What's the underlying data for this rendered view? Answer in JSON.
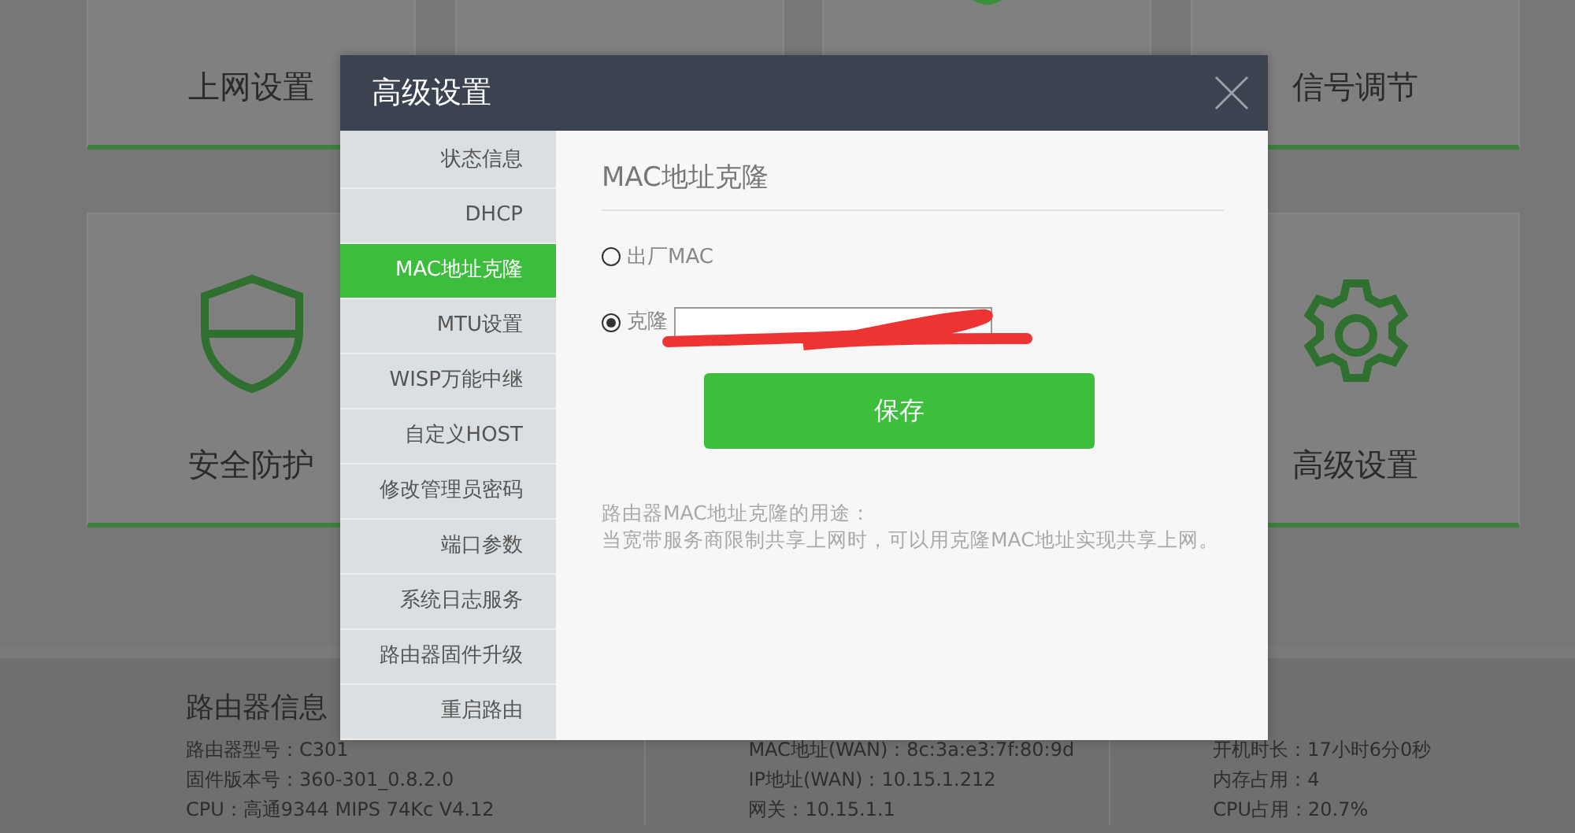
{
  "dashboard": {
    "tile_rows": [
      [
        {
          "kind": "label",
          "label": "上网设置"
        },
        {
          "kind": "blank"
        },
        {
          "kind": "blip"
        },
        {
          "kind": "label",
          "label": "信号调节"
        }
      ],
      [
        {
          "kind": "shield",
          "label": "安全防护"
        },
        {
          "kind": "gear",
          "label": "高级设置"
        }
      ]
    ],
    "info": {
      "title": "路由器信息",
      "columns": [
        [
          "路由器型号：C301",
          "固件版本号：360-301_0.8.2.0",
          "CPU：高通9344 MIPS 74Kc V4.12"
        ],
        [
          "MAC地址(WAN)：8c:3a:e3:7f:80:9d",
          "IP地址(WAN)：10.15.1.212",
          "网关：10.15.1.1"
        ],
        [
          "开机时长：17小时6分0秒",
          "内存占用：4",
          "CPU占用：20.7%"
        ]
      ]
    }
  },
  "dialog": {
    "title": "高级设置",
    "sidebar": [
      {
        "label": "状态信息",
        "selected": false
      },
      {
        "label": "DHCP",
        "selected": false
      },
      {
        "label": "MAC地址克隆",
        "selected": true
      },
      {
        "label": "MTU设置",
        "selected": false
      },
      {
        "label": "WISP万能中继",
        "selected": false
      },
      {
        "label": "自定义HOST",
        "selected": false
      },
      {
        "label": "修改管理员密码",
        "selected": false
      },
      {
        "label": "端口参数",
        "selected": false
      },
      {
        "label": "系统日志服务",
        "selected": false
      },
      {
        "label": "路由器固件升级",
        "selected": false
      },
      {
        "label": "重启路由",
        "selected": false
      }
    ],
    "heading": "MAC地址克隆",
    "options": [
      {
        "kind": "plain",
        "label": "出厂MAC",
        "selected": false
      },
      {
        "kind": "field",
        "label": "克隆",
        "selected": true,
        "redacted": true
      }
    ],
    "save": "保存",
    "notes": [
      "路由器MAC地址克隆的用途：",
      "当宽带服务商限制共享上网时，可以用克隆MAC地址实现共享上网。"
    ]
  }
}
